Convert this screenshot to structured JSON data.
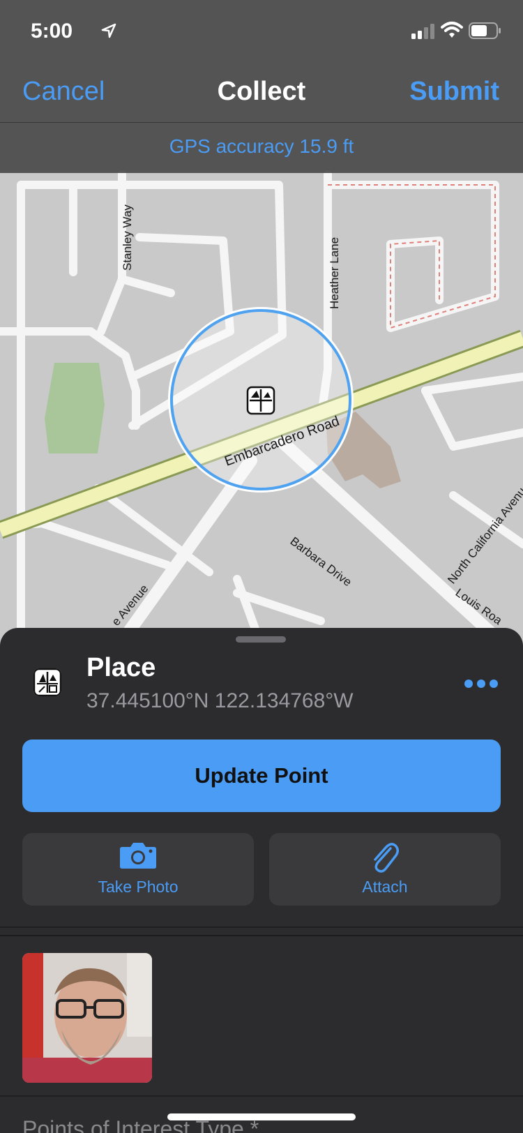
{
  "status_bar": {
    "time": "5:00"
  },
  "nav": {
    "cancel_label": "Cancel",
    "title": "Collect",
    "submit_label": "Submit"
  },
  "gps": {
    "accuracy_text": "GPS accuracy 15.9 ft"
  },
  "map": {
    "streets": {
      "embarcadero": "Embarcadero Road",
      "stanley": "Stanley Way",
      "heather": "Heather Lane",
      "barbara": "Barbara Drive",
      "north_california": "North California Avenu",
      "louis": "Louis Roa",
      "avenue_partial": "e Avenue"
    }
  },
  "sheet": {
    "place_name": "Place",
    "coordinates": "37.445100°N  122.134768°W",
    "update_point_label": "Update Point",
    "take_photo_label": "Take Photo",
    "attach_label": "Attach",
    "poi_type_label": "Points of Interest Type *"
  },
  "colors": {
    "accent": "#4a9cf5",
    "sheet_bg": "#2c2c2e",
    "button_bg": "#3a3a3c"
  }
}
